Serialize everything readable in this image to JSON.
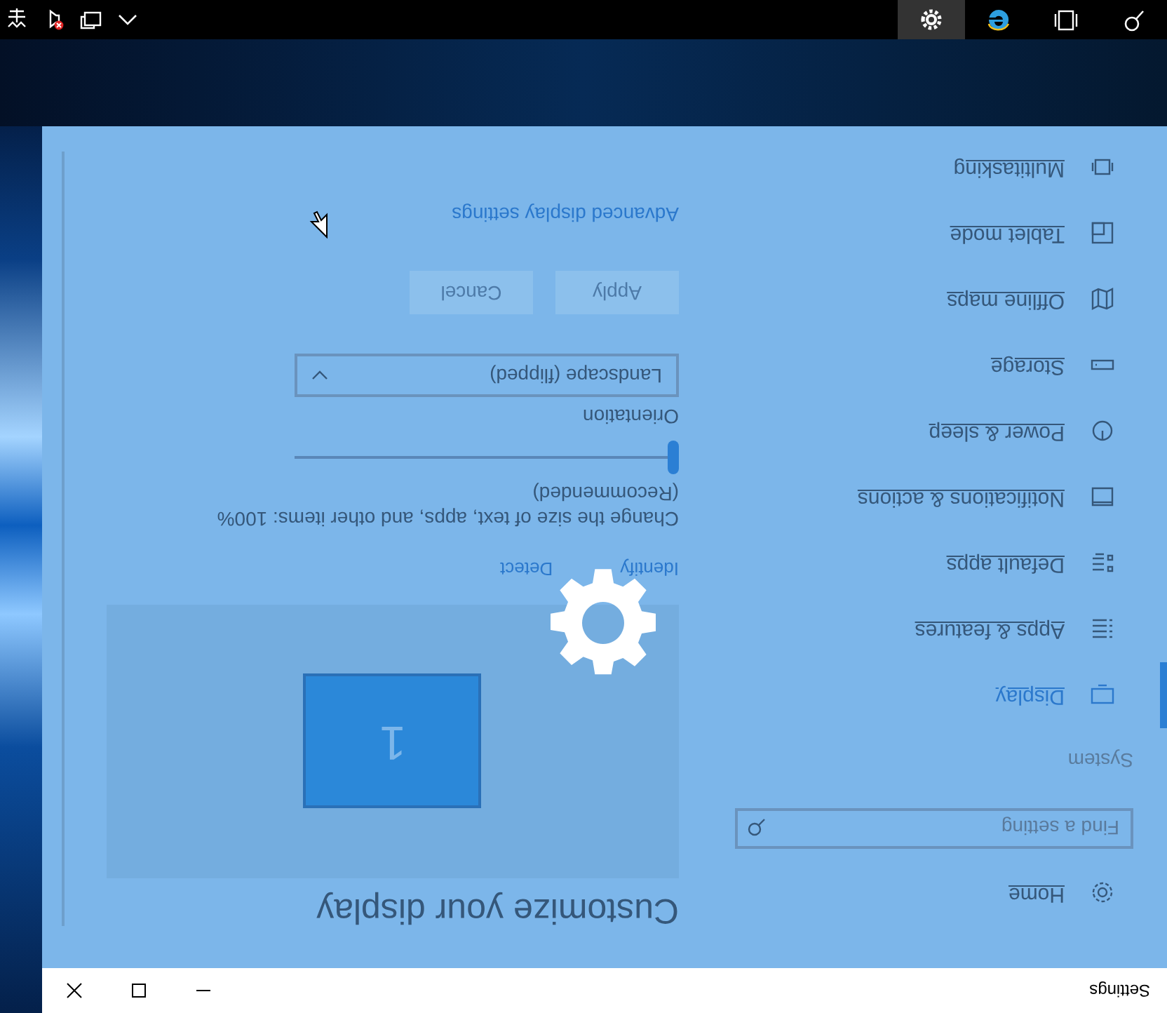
{
  "window": {
    "title": "Settings"
  },
  "sidebar": {
    "home": "Home",
    "search": {
      "placeholder": "Find a setting"
    },
    "section": "System",
    "items": [
      {
        "label": "Display",
        "kind": "display",
        "selected": true
      },
      {
        "label": "Apps & features",
        "kind": "list",
        "selected": false
      },
      {
        "label": "Default apps",
        "kind": "defaults",
        "selected": false
      },
      {
        "label": "Notifications & actions",
        "kind": "notifications",
        "selected": false
      },
      {
        "label": "Power & sleep",
        "kind": "power",
        "selected": false
      },
      {
        "label": "Storage",
        "kind": "storage",
        "selected": false
      },
      {
        "label": "Offline maps",
        "kind": "map",
        "selected": false
      },
      {
        "label": "Tablet mode",
        "kind": "tablet",
        "selected": false
      },
      {
        "label": "Multitasking",
        "kind": "multitasking",
        "selected": false
      }
    ]
  },
  "content": {
    "heading": "Customize your display",
    "monitor_label": "1",
    "links": [
      "Identify",
      "Detect"
    ],
    "scale_label": "Change the size of text, apps, and other items: 100% (Recommended)",
    "scale_slider": {
      "level": 0
    },
    "orientation_label": "Orientation",
    "orientation": {
      "value": "Landscape (flipped)"
    },
    "buttons": [
      {
        "label": "Apply",
        "disabled": true
      },
      {
        "label": "Cancel",
        "disabled": true
      }
    ],
    "advanced_link": "Advanced display settings"
  },
  "taskbar": {
    "apps": [
      {
        "kind": "search",
        "selected": false
      },
      {
        "kind": "task-view",
        "selected": false
      },
      {
        "kind": "browser",
        "selected": false
      },
      {
        "kind": "settings",
        "selected": true
      }
    ],
    "tray": [
      {
        "kind": "chevron"
      },
      {
        "kind": "network"
      },
      {
        "kind": "volume-muted"
      },
      {
        "kind": "input"
      }
    ]
  }
}
